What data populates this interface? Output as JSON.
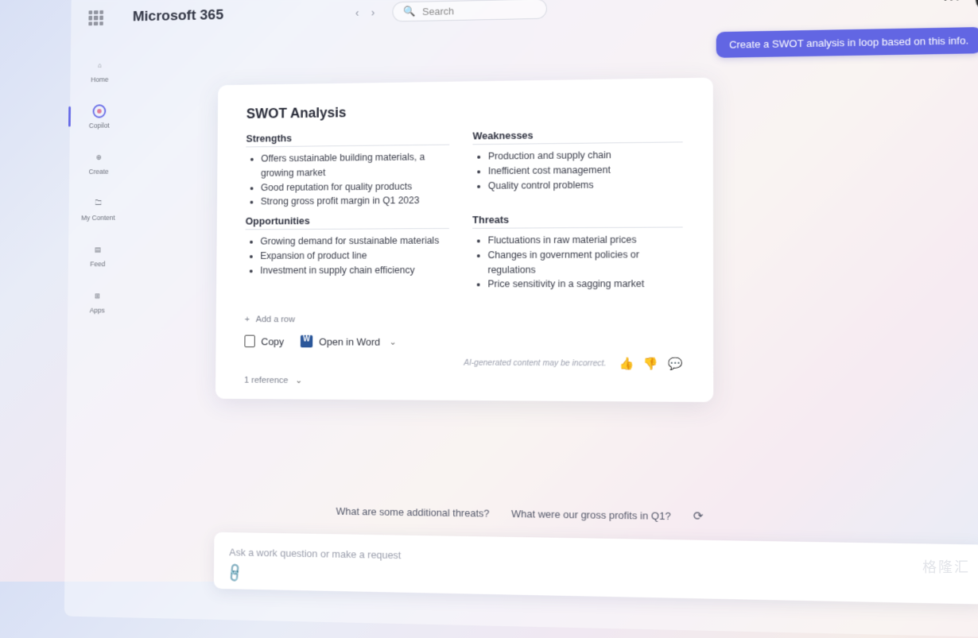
{
  "header": {
    "brand": "Microsoft 365",
    "search_placeholder": "Search"
  },
  "sidebar": {
    "items": [
      {
        "label": "Home",
        "icon": "home-icon"
      },
      {
        "label": "Copilot",
        "icon": "copilot-icon"
      },
      {
        "label": "Create",
        "icon": "create-icon"
      },
      {
        "label": "My Content",
        "icon": "content-icon"
      },
      {
        "label": "Feed",
        "icon": "feed-icon"
      },
      {
        "label": "Apps",
        "icon": "apps-icon"
      }
    ]
  },
  "conversation": {
    "user_message": "Create a SWOT analysis in loop based on this info."
  },
  "swot": {
    "title": "SWOT Analysis",
    "strengths": {
      "heading": "Strengths",
      "items": [
        "Offers sustainable building materials, a growing market",
        "Good reputation for quality products",
        "Strong gross profit margin in Q1 2023"
      ]
    },
    "weaknesses": {
      "heading": "Weaknesses",
      "items": [
        "Production and supply chain",
        "Inefficient cost management",
        "Quality control problems"
      ]
    },
    "opportunities": {
      "heading": "Opportunities",
      "items": [
        "Growing demand for sustainable materials",
        "Expansion of product line",
        "Investment in supply chain efficiency"
      ]
    },
    "threats": {
      "heading": "Threats",
      "items": [
        "Fluctuations in raw material prices",
        "Changes in government policies or regulations",
        "Price sensitivity in a sagging market"
      ]
    },
    "add_row": "Add a row"
  },
  "actions": {
    "copy": "Copy",
    "open_word": "Open in Word",
    "disclaimer": "AI-generated content may be incorrect.",
    "reference": "1 reference"
  },
  "suggestions": {
    "s1": "What are some additional threats?",
    "s2": "What were our gross profits in Q1?"
  },
  "composer": {
    "placeholder": "Ask a work question or make a request"
  },
  "watermark": "格隆汇"
}
